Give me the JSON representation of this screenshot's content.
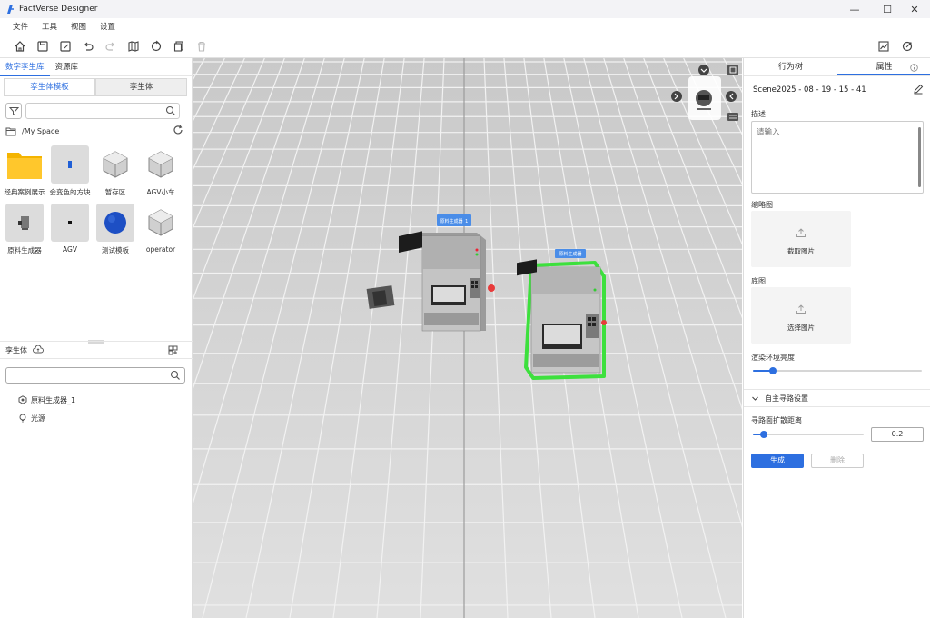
{
  "app": {
    "title": "FactVerse Designer"
  },
  "window_controls": {
    "minimize": "—",
    "maximize": "☐",
    "close": "✕"
  },
  "menu": [
    "文件",
    "工具",
    "视图",
    "设置"
  ],
  "left_panel": {
    "tabs": [
      "数字孪生库",
      "资源库"
    ],
    "sub_tabs": [
      "孪生体模板",
      "孪生体"
    ],
    "search_placeholder": "",
    "path": "/My Space",
    "assets": [
      {
        "label": "经典案例展示",
        "icon": "folder-icon"
      },
      {
        "label": "会变色的方块",
        "icon": "block-icon"
      },
      {
        "label": "暂存区",
        "icon": "cube-icon"
      },
      {
        "label": "AGV小车",
        "icon": "cube-icon"
      },
      {
        "label": "原料生成器",
        "icon": "machine-icon"
      },
      {
        "label": "AGV",
        "icon": "block-icon"
      },
      {
        "label": "测试模板",
        "icon": "sphere-icon"
      },
      {
        "label": "operator",
        "icon": "cube-icon"
      }
    ],
    "scene": {
      "title": "孪生体",
      "search_placeholder": "",
      "items": [
        {
          "label": "原料生成器_1",
          "icon": "hexagon-icon"
        },
        {
          "label": "光源",
          "icon": "light-icon"
        }
      ]
    }
  },
  "viewport": {
    "machine_labels": [
      "原料生成器_1",
      "原料生成器"
    ]
  },
  "right_panel": {
    "tabs": [
      "行为树",
      "属性"
    ],
    "scene_name": "Scene2025 - 08 - 19 - 15 - 41",
    "description_label": "描述",
    "description_placeholder": "请输入",
    "thumbnail_label": "缩略图",
    "thumbnail_button": "截取图片",
    "base_label": "底图",
    "base_button": "选择图片",
    "brightness_label": "渲染环境亮度",
    "brightness_value": 0.12,
    "nav_section": "自主寻路设置",
    "nav_distance_label": "寻路面扩散距离",
    "nav_distance_value": "0.2",
    "nav_distance_fraction": 0.1,
    "generate_button": "生成",
    "delete_button": "删除"
  },
  "colors": {
    "accent": "#2d6fe0",
    "selection": "#3de03d"
  }
}
